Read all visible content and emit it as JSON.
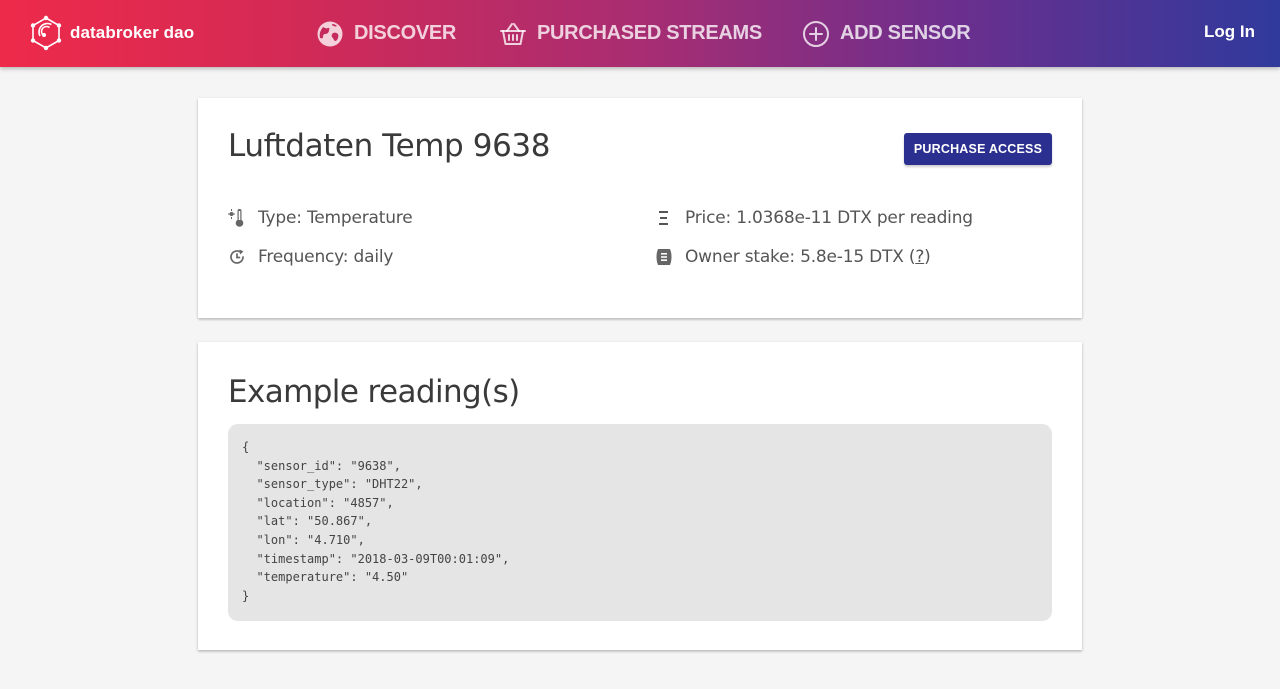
{
  "header": {
    "brand_name": "databroker dao",
    "nav": [
      {
        "label": "DISCOVER",
        "icon": "globe-icon"
      },
      {
        "label": "PURCHASED STREAMS",
        "icon": "basket-icon"
      },
      {
        "label": "ADD SENSOR",
        "icon": "plus-circle-icon"
      }
    ],
    "login_label": "Log In"
  },
  "sensor": {
    "title": "Luftdaten Temp 9638",
    "purchase_label": "PURCHASE ACCESS",
    "type": "Type: Temperature",
    "frequency": "Frequency: daily",
    "price": "Price: 1.0368e-11 DTX per reading",
    "owner_stake": "Owner stake: 5.8e-15 DTX",
    "owner_stake_help": "?"
  },
  "example": {
    "title": "Example reading(s)",
    "code": "{\n  \"sensor_id\": \"9638\",\n  \"sensor_type\": \"DHT22\",\n  \"location\": \"4857\",\n  \"lat\": \"50.867\",\n  \"lon\": \"4.710\",\n  \"timestamp\": \"2018-03-09T00:01:09\",\n  \"temperature\": \"4.50\"\n}"
  },
  "colors": {
    "gradient_start": "#ee2a4a",
    "gradient_end": "#2f3a9c",
    "primary_button": "#2b2f8f",
    "code_background": "#e5e5e5",
    "page_background": "#f5f5f5"
  }
}
